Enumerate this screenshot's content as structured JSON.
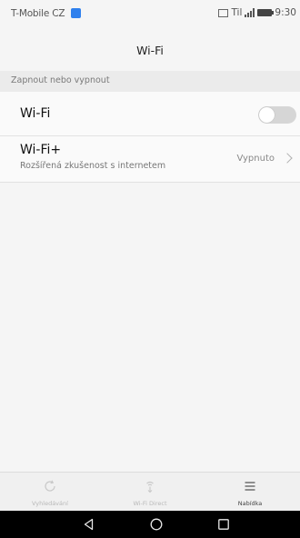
{
  "status_bar": {
    "carrier": "T-Mobile CZ",
    "signal_label": "Til",
    "time": "9:30"
  },
  "header": {
    "title": "Wi-Fi"
  },
  "section": {
    "title": "Zapnout nebo vypnout"
  },
  "wifi_row": {
    "label": "Wi-Fi",
    "toggle_on": false
  },
  "wifiplus_row": {
    "label": "Wi-Fi+",
    "subtitle": "Rozšířená zkušenost s internetem",
    "value": "Vypnuto"
  },
  "bottom_bar": {
    "items": [
      {
        "label": "Vyhledávání",
        "icon": "refresh-icon",
        "enabled": false
      },
      {
        "label": "Wi-Fi Direct",
        "icon": "wifi-direct-icon",
        "enabled": false
      },
      {
        "label": "Nabídka",
        "icon": "menu-icon",
        "enabled": true
      }
    ]
  },
  "nav_bar": {
    "buttons": [
      "back-icon",
      "home-icon",
      "recents-icon"
    ]
  },
  "colors": {
    "background": "#f5f5f5",
    "section_header": "#ebebeb",
    "toggle_off": "#d6d6d6",
    "nav_bar": "#000000",
    "carrier_badge": "#2f80ed"
  }
}
